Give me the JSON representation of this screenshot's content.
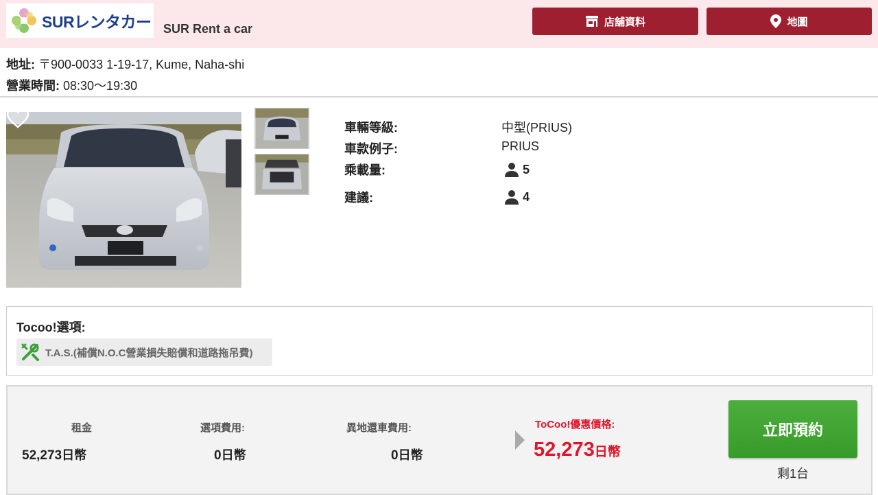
{
  "header": {
    "logo_text": "SURレンタカー",
    "shop_name": "SUR Rent a car",
    "store_button_label": "店舖資料",
    "map_button_label": "地圖",
    "bg_color": "#fce8ea",
    "button_color": "#9e2030"
  },
  "address": {
    "address_label": "地址:",
    "address_value": "〒900-0033 1-19-17, Kume, Naha-shi",
    "hours_label": "營業時間:",
    "hours_value": "08:30〜19:30"
  },
  "specs": {
    "class_label": "車輛等級:",
    "class_value": "中型(PRIUS)",
    "model_label": "車款例子:",
    "model_value": "PRIUS",
    "capacity_label": "乘載量:",
    "capacity_value": "5",
    "suggest_label": "建議:",
    "suggest_value": "4"
  },
  "options": {
    "title": "Tocoo!選項:",
    "tag_label": "T.A.S.(補償N.O.C營業損失賠償和道路拖吊費)"
  },
  "price": {
    "rent_label": "租金",
    "rent_value": "52,273",
    "rent_unit": "日幣",
    "option_label": "選項費用:",
    "option_value": "0",
    "option_unit": "日幣",
    "dropoff_label": "異地還車費用:",
    "dropoff_value": "0",
    "dropoff_unit": "日幣",
    "tocoo_label": "ToCoo!優惠價格:",
    "tocoo_value": "52,273",
    "tocoo_unit": "日幣",
    "book_label": "立即預約",
    "remain_label": "剩1台",
    "accent_color": "#e0142a",
    "book_color": "#4caf3c"
  }
}
